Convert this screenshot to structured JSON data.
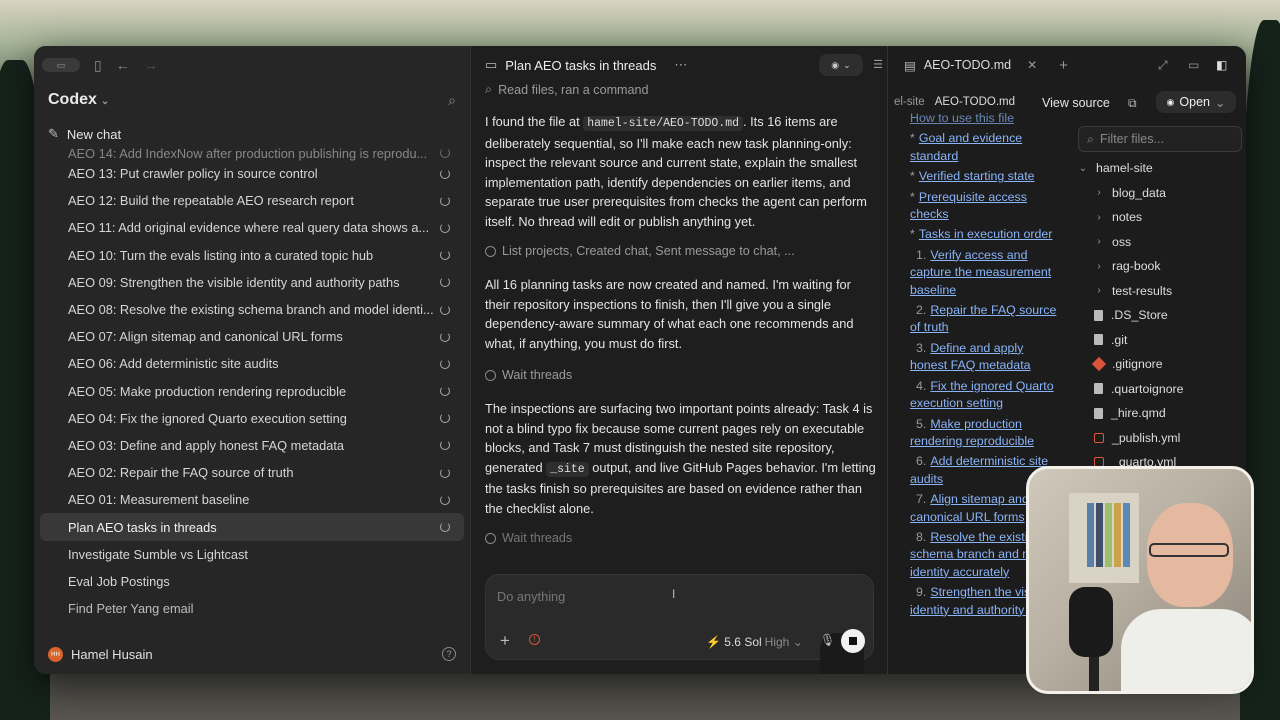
{
  "sidebar": {
    "brand": "Codex",
    "new_chat": "New chat",
    "items": [
      {
        "label": "AEO 14: Add IndexNow after production publishing is reprodu...",
        "spinning": true
      },
      {
        "label": "AEO 13: Put crawler policy in source control",
        "spinning": true
      },
      {
        "label": "AEO 12: Build the repeatable AEO research report",
        "spinning": true
      },
      {
        "label": "AEO 11: Add original evidence where real query data shows a...",
        "spinning": true
      },
      {
        "label": "AEO 10: Turn the evals listing into a curated topic hub",
        "spinning": true
      },
      {
        "label": "AEO 09: Strengthen the visible identity and authority paths",
        "spinning": true
      },
      {
        "label": "AEO 08: Resolve the existing schema branch and model identi...",
        "spinning": true
      },
      {
        "label": "AEO 07: Align sitemap and canonical URL forms",
        "spinning": true
      },
      {
        "label": "AEO 06: Add deterministic site audits",
        "spinning": true
      },
      {
        "label": "AEO 05: Make production rendering reproducible",
        "spinning": true
      },
      {
        "label": "AEO 04: Fix the ignored Quarto execution setting",
        "spinning": true
      },
      {
        "label": "AEO 03: Define and apply honest FAQ metadata",
        "spinning": true
      },
      {
        "label": "AEO 02: Repair the FAQ source of truth",
        "spinning": true
      },
      {
        "label": "AEO 01: Measurement baseline",
        "spinning": true
      },
      {
        "label": "Plan AEO tasks in threads",
        "spinning": true
      },
      {
        "label": "Investigate Sumble vs Lightcast",
        "spinning": false
      },
      {
        "label": "Eval Job Postings",
        "spinning": false
      },
      {
        "label": "Find Peter Yang email",
        "spinning": false
      }
    ],
    "user": "Hamel Husain",
    "user_initials": "HH",
    "help": "?"
  },
  "chat": {
    "title": "Plan AEO tasks in threads",
    "tool_top": "Read files, ran a command",
    "msg1_a": "I found the file at ",
    "msg1_code": "hamel-site/AEO-TODO.md",
    "msg1_b": ". Its 16 items are deliberately sequential, so I'll make each new task planning-only: inspect the relevant source and current state, explain the smallest implementation path, identify dependencies on earlier items, and separate true user prerequisites from checks the agent can perform itself. No thread will edit or publish anything yet.",
    "tool2": "List projects, Created chat, Sent message to chat, ...",
    "msg2": "All 16 planning tasks are now created and named. I'm waiting for their repository inspections to finish, then I'll give you a single dependency-aware summary of what each one recommends and what, if anything, you must do first.",
    "tool3": "Wait threads",
    "msg3_a": "The inspections are surfacing two important points already: Task 4 is not a blind typo fix because some current pages rely on executable blocks, and Task 7 must distinguish the nested site repository, generated ",
    "msg3_code": "_site",
    "msg3_b": " output, and live GitHub Pages behavior. I'm letting the tasks finish so prerequisites are based on evidence rather than the checklist alone.",
    "tool4": "Wait threads",
    "composer_placeholder": "Do anything",
    "model": "5.6 Sol",
    "level": "High"
  },
  "right": {
    "tab": "AEO-TODO.md",
    "crumb_parent": "el-site",
    "crumb_file": "AEO-TODO.md",
    "view_source": "View source",
    "open": "Open",
    "doc_top": "How to use this file",
    "bullets": [
      "Goal and evidence standard",
      "Verified starting state",
      "Prerequisite access checks",
      "Tasks in execution order"
    ],
    "numbered": [
      {
        "n": "1.",
        "t": "Verify access and capture the measurement baseline"
      },
      {
        "n": "2.",
        "t": "Repair the FAQ source of truth"
      },
      {
        "n": "3.",
        "t": "Define and apply honest FAQ metadata"
      },
      {
        "n": "4.",
        "t": "Fix the ignored Quarto execution setting"
      },
      {
        "n": "5.",
        "t": "Make production rendering reproducible"
      },
      {
        "n": "6.",
        "t": "Add deterministic site audits"
      },
      {
        "n": "7.",
        "t": "Align sitemap and canonical URL forms"
      },
      {
        "n": "8.",
        "t": "Resolve the existing schema branch and model identity accurately"
      },
      {
        "n": "9.",
        "t": "Strengthen the visible identity and authority paths"
      }
    ],
    "filter_placeholder": "Filter files...",
    "root": "hamel-site",
    "folders": [
      "blog_data",
      "notes",
      "oss",
      "rag-book",
      "test-results"
    ],
    "files": [
      {
        "name": ".DS_Store",
        "kind": "file"
      },
      {
        "name": ".git",
        "kind": "file"
      },
      {
        "name": ".gitignore",
        "kind": "git"
      },
      {
        "name": ".quartoignore",
        "kind": "file"
      },
      {
        "name": "_hire.qmd",
        "kind": "file"
      },
      {
        "name": "_publish.yml",
        "kind": "yml"
      },
      {
        "name": "_quarto.yml",
        "kind": "yml"
      }
    ]
  }
}
